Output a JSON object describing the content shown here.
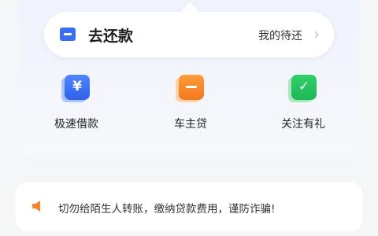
{
  "repay": {
    "title": "去还款",
    "link": "我的待还",
    "chevron": "›",
    "icon": "card-icon"
  },
  "shortcuts": [
    {
      "label": "极速借款",
      "icon": "yuan-icon",
      "glyph": "¥",
      "color": "#3b6df0"
    },
    {
      "label": "车主贷",
      "icon": "car-icon",
      "color": "#f5832a"
    },
    {
      "label": "关注有礼",
      "icon": "check-icon",
      "glyph": "✓",
      "color": "#22c25d"
    }
  ],
  "notice": {
    "text": "切勿给陌生人转账，缴纳贷款费用，谨防诈骗!",
    "icon": "speaker-icon",
    "icon_color": "#f5832a"
  }
}
